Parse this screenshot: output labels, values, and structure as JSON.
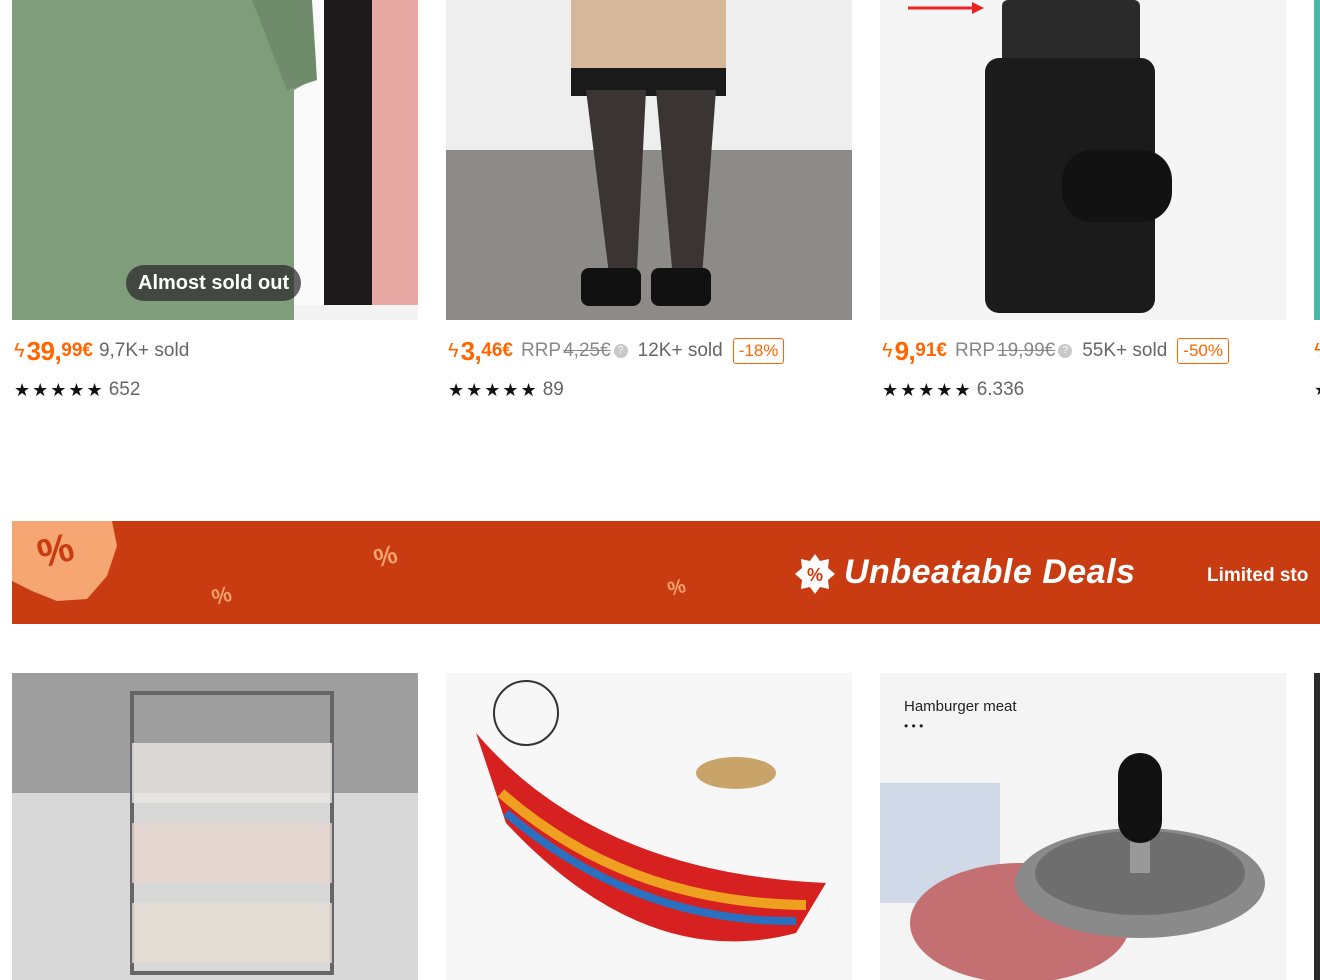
{
  "products_top": [
    {
      "name": "Women's T-shirt",
      "badge": "Almost sold out",
      "price_main": "39,",
      "price_cents": "99€",
      "sold": "9,7K+ sold",
      "rating_count": "652"
    },
    {
      "name": "Tights",
      "price_main": "3,",
      "price_cents": "46€",
      "rrp_label": "RRP",
      "rrp_value": "4,25€",
      "sold": "12K+ sold",
      "discount": "-18%",
      "rating_count": "89"
    },
    {
      "name": "Card wallet",
      "price_main": "9,",
      "price_cents": "91€",
      "rrp_label": "RRP",
      "rrp_value": "19,99€",
      "sold": "55K+ sold",
      "discount": "-50%",
      "rating_count": "6.336"
    }
  ],
  "stars": "★★★★★",
  "banner": {
    "title": "Unbeatable Deals",
    "subtitle": "Limited sto",
    "percent_symbol": "%"
  },
  "products_bottom": [
    {
      "name": "Storage trolley"
    },
    {
      "name": "Hammock"
    },
    {
      "name": "Burger press",
      "image_caption": "Hamburger meat",
      "image_dots": "• • •"
    }
  ],
  "colors": {
    "accent": "#ff6600",
    "banner_bg": "#c93c12"
  },
  "icons": [
    "lightning-icon",
    "info-icon",
    "star-icon",
    "percent-icon"
  ]
}
